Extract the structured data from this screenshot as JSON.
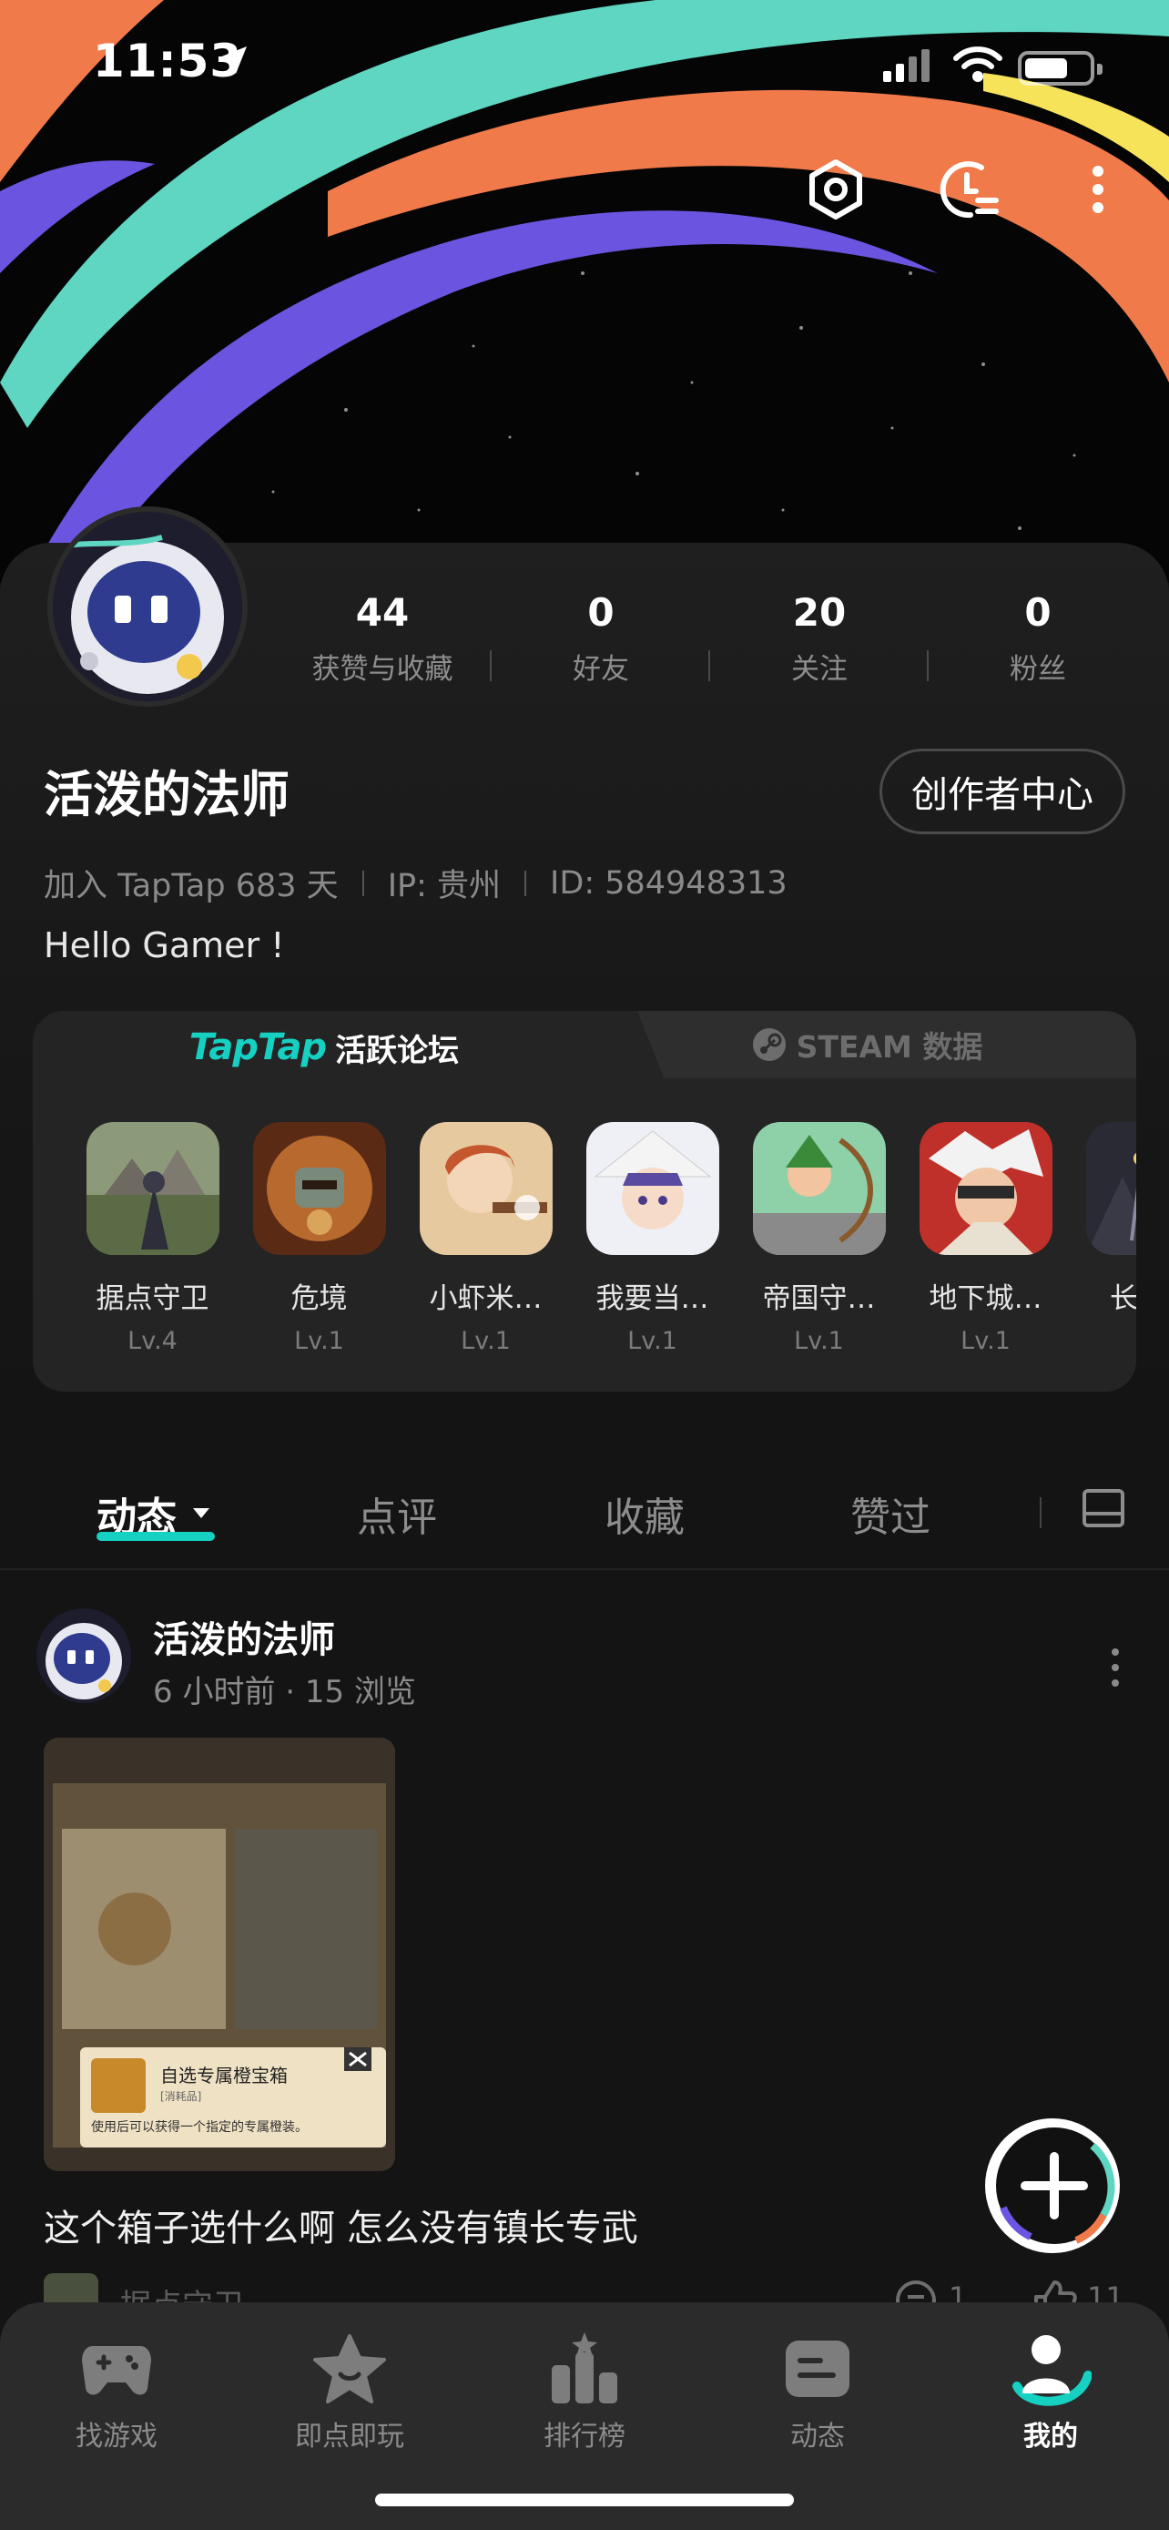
{
  "status_bar": {
    "time": "11:53"
  },
  "profile": {
    "stats": [
      {
        "value": "44",
        "label": "获赞与收藏"
      },
      {
        "value": "0",
        "label": "好友"
      },
      {
        "value": "20",
        "label": "关注"
      },
      {
        "value": "0",
        "label": "粉丝"
      }
    ],
    "username": "活泼的法师",
    "creator_button": "创作者中心",
    "joined": "加入 TapTap 683 天",
    "ip": "IP: 贵州",
    "id": "ID: 584948313",
    "bio": "Hello Gamer !"
  },
  "panel": {
    "tab_logo": "TapTap",
    "tab_forum": "活跃论坛",
    "tab_steam": "STEAM 数据",
    "games": [
      {
        "name": "据点守卫",
        "level": "Lv.4",
        "color": "#6d7a5a"
      },
      {
        "name": "危境",
        "level": "Lv.1",
        "color": "#8a4a2a"
      },
      {
        "name": "小虾米…",
        "level": "Lv.1",
        "color": "#c98a4a"
      },
      {
        "name": "我要当…",
        "level": "Lv.1",
        "color": "#d8d8e8"
      },
      {
        "name": "帝国守…",
        "level": "Lv.1",
        "color": "#5aa04a"
      },
      {
        "name": "地下城…",
        "level": "Lv.1",
        "color": "#a03a3a"
      },
      {
        "name": "长生劫",
        "level": "-",
        "color": "#3a3a4a"
      }
    ]
  },
  "feed_tabs": [
    {
      "label": "动态",
      "active": true
    },
    {
      "label": "点评",
      "active": false
    },
    {
      "label": "收藏",
      "active": false
    },
    {
      "label": "赞过",
      "active": false
    }
  ],
  "post": {
    "author": "活泼的法师",
    "meta": "6 小时前 · 15 浏览",
    "image_title": "自选专属橙宝箱",
    "image_subtitle": "[消耗品]",
    "image_desc": "使用后可以获得一个指定的专属橙装。",
    "text": "这个箱子选什么啊 怎么没有镇长专武",
    "tag_game": "据点守卫",
    "comment_count": "1",
    "like_count": "11"
  },
  "bottom_nav": [
    {
      "label": "找游戏",
      "icon": "gamepad-icon",
      "active": false
    },
    {
      "label": "即点即玩",
      "icon": "star-icon",
      "active": false
    },
    {
      "label": "排行榜",
      "icon": "ranking-icon",
      "active": false
    },
    {
      "label": "动态",
      "icon": "feed-icon",
      "active": false
    },
    {
      "label": "我的",
      "icon": "profile-icon",
      "active": true
    }
  ],
  "colors": {
    "accent": "#16d0c2",
    "banner_orange": "#f07a4a",
    "banner_teal": "#5fd6c1",
    "banner_purple": "#6b55e0",
    "banner_yellow": "#f6e35a"
  }
}
